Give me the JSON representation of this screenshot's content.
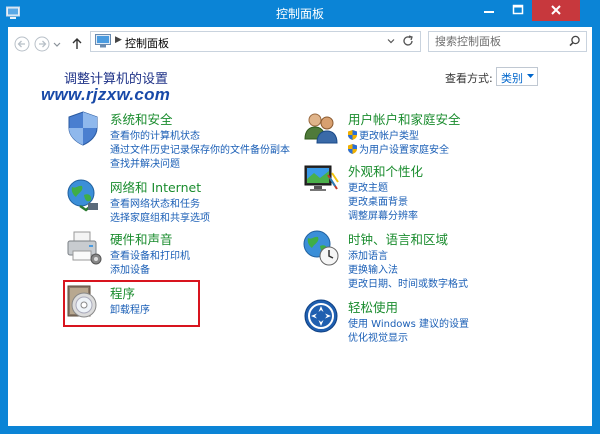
{
  "window": {
    "title": "控制面板"
  },
  "toolbar": {
    "address_path": "控制面板",
    "search_placeholder": "搜索控制面板"
  },
  "header": {
    "page_title": "调整计算机的设置",
    "watermark": "www.rjzxw.com",
    "view_by_label": "查看方式:",
    "view_by_value": "类别"
  },
  "categories": {
    "system": {
      "title": "系统和安全",
      "links": [
        "查看你的计算机状态",
        "通过文件历史记录保存你的文件备份副本",
        "查找并解决问题"
      ]
    },
    "network": {
      "title": "网络和 Internet",
      "links": [
        "查看网络状态和任务",
        "选择家庭组和共享选项"
      ]
    },
    "hardware": {
      "title": "硬件和声音",
      "links": [
        "查看设备和打印机",
        "添加设备"
      ]
    },
    "programs": {
      "title": "程序",
      "links": [
        "卸载程序"
      ]
    },
    "user": {
      "title": "用户帐户和家庭安全",
      "links": [
        "更改帐户类型",
        "为用户设置家庭安全"
      ]
    },
    "appearance": {
      "title": "外观和个性化",
      "links": [
        "更改主题",
        "更改桌面背景",
        "调整屏幕分辨率"
      ]
    },
    "clock": {
      "title": "时钟、语言和区域",
      "links": [
        "添加语言",
        "更换输入法",
        "更改日期、时间或数字格式"
      ]
    },
    "ease": {
      "title": "轻松使用",
      "links": [
        "使用 Windows 建议的设置",
        "优化视觉显示"
      ]
    }
  },
  "colors": {
    "window_frame": "#0b84d6",
    "category_title": "#1a8c2e",
    "link": "#1b5fb6",
    "page_title": "#1e3287",
    "highlight_box": "#d8141e"
  }
}
